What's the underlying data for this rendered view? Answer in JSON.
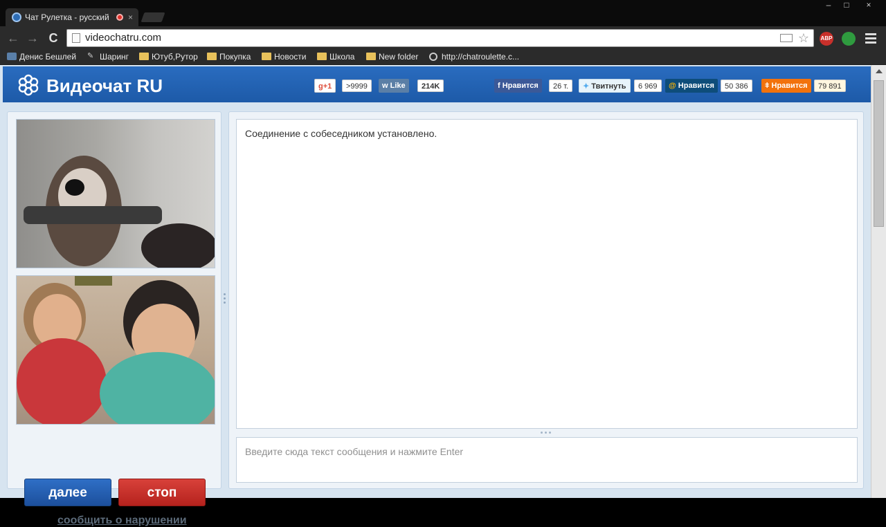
{
  "browser": {
    "tab_title": "Чат Рулетка - русский",
    "tab_close": "×",
    "url": "videochatru.com",
    "win_min": "‒",
    "win_max": "□",
    "win_close": "×",
    "ext_abp": "ABP",
    "bookmarks": [
      {
        "label": "Денис Бешлей",
        "icon": "vk-icon"
      },
      {
        "label": "Шаринг",
        "icon": "pen-icon"
      },
      {
        "label": "Ютуб,Рутор",
        "icon": "folder-icon"
      },
      {
        "label": "Покупка",
        "icon": "folder-icon"
      },
      {
        "label": "Новости",
        "icon": "folder-icon"
      },
      {
        "label": "Школа",
        "icon": "folder-icon"
      },
      {
        "label": "New folder",
        "icon": "folder-icon"
      },
      {
        "label": "http://chatroulette.c...",
        "icon": "globe-icon"
      }
    ]
  },
  "site": {
    "logo": "Видеочат RU",
    "share": {
      "gplus": {
        "label": "g+1",
        "count": ">9999",
        "color": "#dd4b39"
      },
      "vk": {
        "label": "Like",
        "count": "214K",
        "color": "#5b7fa6"
      },
      "facebook": {
        "label": "Нравится",
        "count": "26 т.",
        "color": "#3b5998"
      },
      "twitter": {
        "label": "Твитнуть",
        "count": "6 969",
        "color": "#55acee"
      },
      "mailru": {
        "label": "Нравится",
        "count": "50 386",
        "color": "#168de2"
      },
      "odnoklassniki": {
        "label": "Нравится",
        "count": "79 891",
        "color": "#f2720c"
      }
    }
  },
  "controls": {
    "next_label": "далее",
    "stop_label": "стоп",
    "report_label": "сообщить о нарушении"
  },
  "chat": {
    "messages": [
      "Соединение с собеседником установлено."
    ],
    "input_placeholder": "Введите сюда текст сообщения и нажмите Enter"
  },
  "colors": {
    "header_blue": "#1d5aa8",
    "next_blue": "#2f6fc6",
    "stop_red": "#c9302c"
  }
}
